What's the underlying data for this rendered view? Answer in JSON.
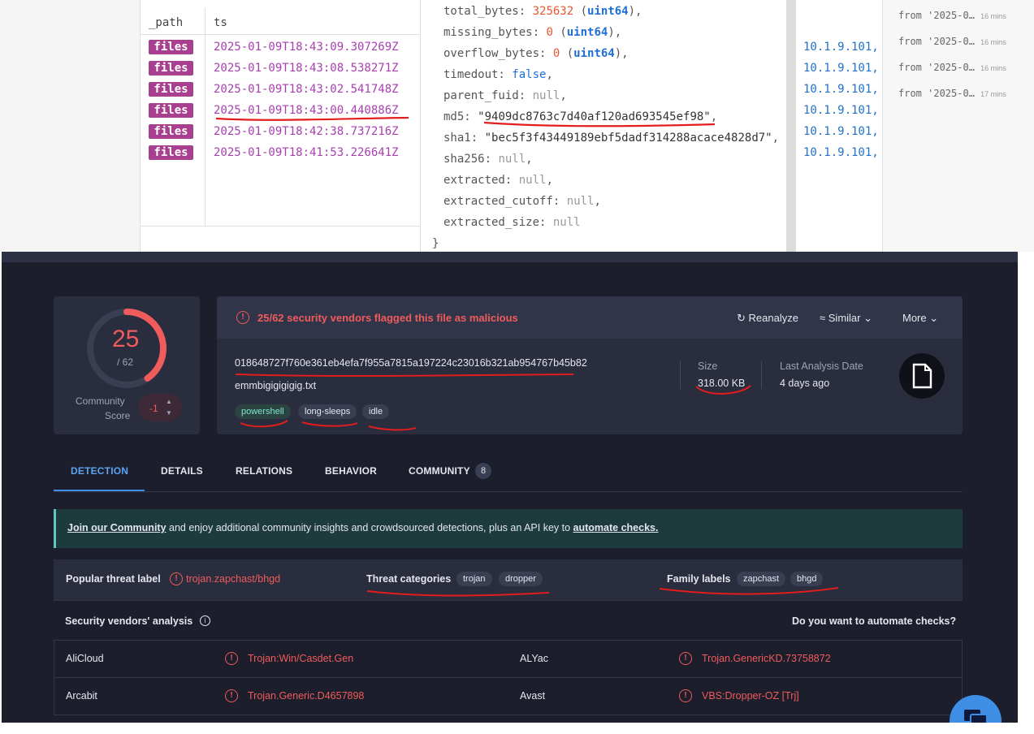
{
  "top": {
    "col_path": "_path",
    "col_ts": "ts",
    "rows": [
      {
        "path": "files",
        "ts": "2025-01-09T18:43:09.307269Z",
        "ip": "10.1.9.101,",
        "from": "from '2025-0…",
        "ago": "16 mins"
      },
      {
        "path": "files",
        "ts": "2025-01-09T18:43:08.538271Z",
        "ip": "10.1.9.101,",
        "from": "from '2025-0…",
        "ago": "16 mins"
      },
      {
        "path": "files",
        "ts": "2025-01-09T18:43:02.541748Z",
        "ip": "10.1.9.101,",
        "from": "from '2025-0…",
        "ago": "16 mins"
      },
      {
        "path": "files",
        "ts": "2025-01-09T18:43:00.440886Z",
        "ip": "10.1.9.101,",
        "from": "from '2025-0…",
        "ago": "17 mins"
      },
      {
        "path": "files",
        "ts": "2025-01-09T18:42:38.737216Z",
        "ip": "10.1.9.101,"
      },
      {
        "path": "files",
        "ts": "2025-01-09T18:41:53.226641Z",
        "ip": "10.1.9.101,"
      }
    ],
    "json": {
      "total_bytes_key": "total_bytes:",
      "total_bytes_val": "325632",
      "total_bytes_type": "uint64",
      "missing_bytes_key": "missing_bytes:",
      "missing_bytes_val": "0",
      "missing_bytes_type": "uint64",
      "overflow_bytes_key": "overflow_bytes:",
      "overflow_bytes_val": "0",
      "overflow_bytes_type": "uint64",
      "timedout_key": "timedout:",
      "timedout_val": "false",
      "parent_fuid_key": "parent_fuid:",
      "parent_fuid_val": "null",
      "md5_key": "md5:",
      "md5_val": "\"9409dc8763c7d40af120ad693545ef98\"",
      "sha1_key": "sha1:",
      "sha1_val": "\"bec5f3f43449189ebf5dadf314288acace4828d7\"",
      "sha256_key": "sha256:",
      "sha256_val": "null",
      "extracted_key": "extracted:",
      "extracted_val": "null",
      "extracted_cutoff_key": "extracted_cutoff:",
      "extracted_cutoff_val": "null",
      "extracted_size_key": "extracted_size:",
      "extracted_size_val": "null",
      "close_brace": "}"
    }
  },
  "vt": {
    "score": "25",
    "score_total": "/ 62",
    "community_label_1": "Community",
    "community_label_2": "Score",
    "community_value": "-1",
    "flag_text": "25/62 security vendors flagged this file as malicious",
    "reanalyze": "Reanalyze",
    "similar": "Similar",
    "more": "More",
    "hash": "018648727f760e361eb4efa7f955a7815a197224c23016b321ab954767b45b82",
    "filename": "emmbigigigigig.txt",
    "tags": [
      "powershell",
      "long-sleeps",
      "idle"
    ],
    "size_label": "Size",
    "size_value": "318.00 KB",
    "last_analysis_label": "Last Analysis Date",
    "last_analysis_value": "4 days ago",
    "tabs": [
      "DETECTION",
      "DETAILS",
      "RELATIONS",
      "BEHAVIOR",
      "COMMUNITY"
    ],
    "community_count": "8",
    "banner_link1": "Join our Community",
    "banner_mid": "and enjoy additional community insights and crowdsourced detections, plus an API key to",
    "banner_link2": "automate checks.",
    "popular_label": "Popular threat label",
    "popular_value": "trojan.zapchast/bhgd",
    "threat_cat_label": "Threat categories",
    "threat_cats": [
      "trojan",
      "dropper"
    ],
    "family_label": "Family labels",
    "families": [
      "zapchast",
      "bhgd"
    ],
    "vendors_title": "Security vendors' analysis",
    "automate_q": "Do you want to automate checks?",
    "vendors": [
      {
        "name": "AliCloud",
        "result": "Trojan:Win/Casdet.Gen",
        "name2": "ALYac",
        "result2": "Trojan.GenericKD.73758872"
      },
      {
        "name": "Arcabit",
        "result": "Trojan.Generic.D4657898",
        "name2": "Avast",
        "result2": "VBS:Dropper-OZ [Trj]"
      }
    ],
    "colors": {
      "bg": "#1d1e2c",
      "card": "#2a2d3e",
      "danger": "#f05b5b",
      "accent": "#3f8ee6",
      "banner": "#1d3b3d"
    },
    "gauge_fraction": 0.403
  },
  "colors": {
    "annotation": "#e11d1d",
    "files_badge": "#a83f8f",
    "ts_text": "#a83fb0"
  }
}
